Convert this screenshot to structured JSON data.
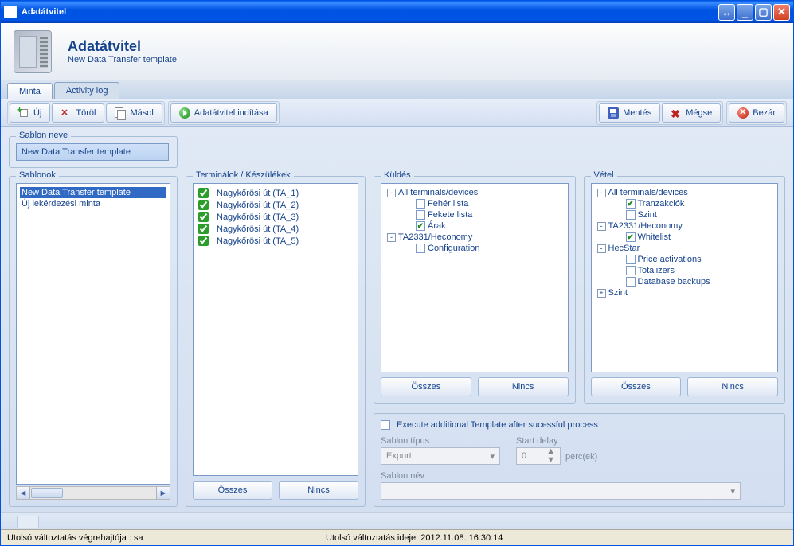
{
  "titlebar": {
    "title": "Adatátvitel"
  },
  "header": {
    "title": "Adatátvitel",
    "subtitle": "New Data Transfer template"
  },
  "tabs": {
    "sample": "Minta",
    "activity_log": "Activity log"
  },
  "toolbar": {
    "new": "Új",
    "delete": "Töröl",
    "copy": "Másol",
    "start": "Adatátvitel indítása",
    "save": "Mentés",
    "cancel": "Mégse",
    "close": "Bezár"
  },
  "template_name": {
    "legend": "Sablon neve",
    "value": "New Data Transfer template"
  },
  "templates": {
    "legend": "Sablonok",
    "items": [
      {
        "label": "New Data Transfer template",
        "selected": true
      },
      {
        "label": "Új lekérdezési minta",
        "selected": false
      }
    ]
  },
  "terminals": {
    "legend": "Terminálok / Készülékek",
    "items": [
      {
        "label": "Nagykőrösi út (TA_1)",
        "checked": true
      },
      {
        "label": "Nagykőrösi út (TA_2)",
        "checked": true
      },
      {
        "label": "Nagykőrösi út (TA_3)",
        "checked": true
      },
      {
        "label": "Nagykőrösi út (TA_4)",
        "checked": true
      },
      {
        "label": "Nagykőrösi út (TA_5)",
        "checked": true
      }
    ],
    "all": "Összes",
    "none": "Nincs"
  },
  "send": {
    "legend": "Küldés",
    "tree": [
      {
        "depth": 0,
        "expander": "-",
        "label": "All terminals/devices"
      },
      {
        "depth": 1,
        "check": false,
        "label": "Fehér lista"
      },
      {
        "depth": 1,
        "check": false,
        "label": "Fekete lista"
      },
      {
        "depth": 1,
        "check": true,
        "label": "Árak"
      },
      {
        "depth": 0,
        "expander": "-",
        "label": "TA2331/Heconomy"
      },
      {
        "depth": 1,
        "check": false,
        "label": "Configuration"
      }
    ],
    "all": "Összes",
    "none": "Nincs"
  },
  "receive": {
    "legend": "Vétel",
    "tree": [
      {
        "depth": 0,
        "expander": "-",
        "label": "All terminals/devices"
      },
      {
        "depth": 1,
        "check": true,
        "label": "Tranzakciók"
      },
      {
        "depth": 1,
        "check": false,
        "label": "Szint"
      },
      {
        "depth": 0,
        "expander": "-",
        "label": "TA2331/Heconomy"
      },
      {
        "depth": 1,
        "check": true,
        "label": "Whitelist"
      },
      {
        "depth": 0,
        "expander": "-",
        "label": "HecStar"
      },
      {
        "depth": 1,
        "check": false,
        "label": "Price activations"
      },
      {
        "depth": 1,
        "check": false,
        "label": "Totalizers"
      },
      {
        "depth": 1,
        "check": false,
        "label": "Database backups"
      },
      {
        "depth": 0,
        "expander": "+",
        "label": "Szint"
      }
    ],
    "all": "Összes",
    "none": "Nincs"
  },
  "extra": {
    "execute_label": "Execute additional Template after sucessful process",
    "execute_checked": false,
    "type_label": "Sablon típus",
    "type_value": "Export",
    "delay_label": "Start delay",
    "delay_value": "0",
    "delay_unit": "perc(ek)",
    "name_label": "Sablon név"
  },
  "status": {
    "left": "Utolsó változtatás végrehajtója : sa",
    "right": "Utolsó változtatás ideje: 2012.11.08. 16:30:14"
  }
}
